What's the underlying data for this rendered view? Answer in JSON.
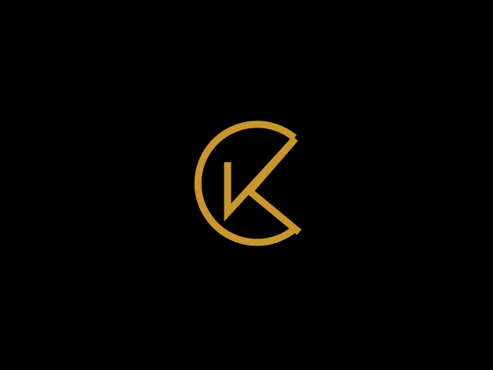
{
  "background_color": "#000000",
  "logo": {
    "icon": "ck-monogram-logo",
    "color": "#C8962C"
  }
}
